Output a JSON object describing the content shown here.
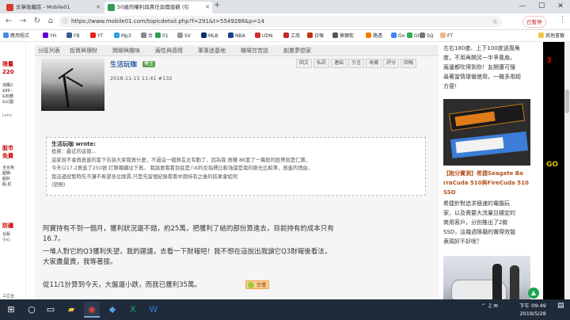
{
  "browser": {
    "tabs": [
      {
        "title": "文章收藏區 - Mobile01",
        "active": false
      },
      {
        "title": "50歲的權利與責任與價值觀 (引",
        "active": true
      }
    ],
    "new_tab": "+",
    "url": "https://www.mobile01.com/topicdetail.php?f=291&t=5549286&p=14",
    "paused_label": "已暫停",
    "bookmarks": [
      "應用程式",
      "YH",
      "FB",
      "YT",
      "Mp3",
      "台",
      "01",
      "SV",
      "MLB",
      "NBA",
      "UDN",
      "工商",
      "日報",
      "華爾街",
      "路透",
      "Go",
      "GI",
      "SQ",
      "FT",
      "其他書籤"
    ]
  },
  "left_ad": {
    "lines": [
      "限量",
      "220",
      "加購2",
      "$99・",
      "&玩轉",
      "&公園",
      "Leno",
      "股市",
      "免費",
      "全台免",
      "超簡",
      "給好",
      "股,紅",
      "防疆",
      "台股",
      "小心",
      "三立台"
    ]
  },
  "forum_nav": [
    "分區列表",
    "投資與理財",
    "閒聊與趣味",
    "兩性與感情",
    "軍事迷基地",
    "職場甘苦談",
    "創業夢想家"
  ],
  "post": {
    "username": "生活玩咖",
    "badge": "樓主",
    "meta": "2018-11-15 11:41  #132",
    "actions": [
      "回文",
      "私訊",
      "連結",
      "引言",
      "收藏",
      "評分",
      "回報"
    ],
    "quote_header": "生活玩咖 wrote:",
    "quote_lines": [
      "投資：最近的這個...",
      "這家就不會再買進的當下告訴大家我買什麼，不過這一檔買在太有動了，因為我 買賺 8K套了一晨股的股票就是仁寶，",
      "今天以17.2買進了250張 打算繼續往下買。 我與要看看到底是八K的反指標比較強還是我的眼光比較準，買進的理由，",
      "我這邊就暫時先不講不希望各位跟賣,只是先留個紀錄看看中期持有之後的結果會如何",
      "(恕刪)"
    ],
    "body_lines": [
      "阿寶持有不到一個月，獲利狀況還不錯，約25萬，把獲利了結的部份算進去，目前持有的成本只有",
      "16.7。",
      "一堆人對它的Q3獲利失望，我的建議，去看一下財報吧！我不想在這說出我讀它Q3財報後看法，",
      "大家盡量賣，我等著接。",
      "從11/1計算到今天，大盤還小跌，而我已獲利35萬。"
    ],
    "emoji_label": "您懂"
  },
  "right_col": {
    "intro_lines": [
      "左右180度、上下100度送風角",
      "度，不用再開另一半爭風扇，",
      "兩邊都吹得到你！友開還可搜",
      "尋著當情環循使用，一機多用超",
      "方便！"
    ],
    "title_lines": [
      "【跑分實測】希捷Seagate Ba",
      "rraCuda 510與FireCuda 510",
      "SSD"
    ],
    "desc_lines": [
      "希捷針對追求極速的電腦玩",
      "家，以及需要大流量且穩定的",
      "商用客戶，分別推出了2款",
      "SSD，這幾週琢磨的實際效能",
      "表現好不好呢？"
    ]
  },
  "far_right": {
    "big": "3",
    "yel": "GO"
  },
  "fab_icon": "▲",
  "taskbar": {
    "time": "下午 09:49",
    "date": "2019/5/28"
  }
}
